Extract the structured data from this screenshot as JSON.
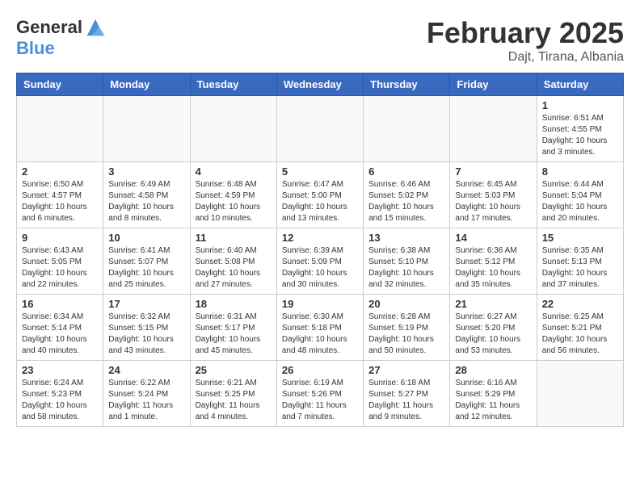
{
  "logo": {
    "line1": "General",
    "line2": "Blue"
  },
  "title": "February 2025",
  "subtitle": "Dajt, Tirana, Albania",
  "days_of_week": [
    "Sunday",
    "Monday",
    "Tuesday",
    "Wednesday",
    "Thursday",
    "Friday",
    "Saturday"
  ],
  "weeks": [
    [
      {
        "day": "",
        "info": ""
      },
      {
        "day": "",
        "info": ""
      },
      {
        "day": "",
        "info": ""
      },
      {
        "day": "",
        "info": ""
      },
      {
        "day": "",
        "info": ""
      },
      {
        "day": "",
        "info": ""
      },
      {
        "day": "1",
        "info": "Sunrise: 6:51 AM\nSunset: 4:55 PM\nDaylight: 10 hours and 3 minutes."
      }
    ],
    [
      {
        "day": "2",
        "info": "Sunrise: 6:50 AM\nSunset: 4:57 PM\nDaylight: 10 hours and 6 minutes."
      },
      {
        "day": "3",
        "info": "Sunrise: 6:49 AM\nSunset: 4:58 PM\nDaylight: 10 hours and 8 minutes."
      },
      {
        "day": "4",
        "info": "Sunrise: 6:48 AM\nSunset: 4:59 PM\nDaylight: 10 hours and 10 minutes."
      },
      {
        "day": "5",
        "info": "Sunrise: 6:47 AM\nSunset: 5:00 PM\nDaylight: 10 hours and 13 minutes."
      },
      {
        "day": "6",
        "info": "Sunrise: 6:46 AM\nSunset: 5:02 PM\nDaylight: 10 hours and 15 minutes."
      },
      {
        "day": "7",
        "info": "Sunrise: 6:45 AM\nSunset: 5:03 PM\nDaylight: 10 hours and 17 minutes."
      },
      {
        "day": "8",
        "info": "Sunrise: 6:44 AM\nSunset: 5:04 PM\nDaylight: 10 hours and 20 minutes."
      }
    ],
    [
      {
        "day": "9",
        "info": "Sunrise: 6:43 AM\nSunset: 5:05 PM\nDaylight: 10 hours and 22 minutes."
      },
      {
        "day": "10",
        "info": "Sunrise: 6:41 AM\nSunset: 5:07 PM\nDaylight: 10 hours and 25 minutes."
      },
      {
        "day": "11",
        "info": "Sunrise: 6:40 AM\nSunset: 5:08 PM\nDaylight: 10 hours and 27 minutes."
      },
      {
        "day": "12",
        "info": "Sunrise: 6:39 AM\nSunset: 5:09 PM\nDaylight: 10 hours and 30 minutes."
      },
      {
        "day": "13",
        "info": "Sunrise: 6:38 AM\nSunset: 5:10 PM\nDaylight: 10 hours and 32 minutes."
      },
      {
        "day": "14",
        "info": "Sunrise: 6:36 AM\nSunset: 5:12 PM\nDaylight: 10 hours and 35 minutes."
      },
      {
        "day": "15",
        "info": "Sunrise: 6:35 AM\nSunset: 5:13 PM\nDaylight: 10 hours and 37 minutes."
      }
    ],
    [
      {
        "day": "16",
        "info": "Sunrise: 6:34 AM\nSunset: 5:14 PM\nDaylight: 10 hours and 40 minutes."
      },
      {
        "day": "17",
        "info": "Sunrise: 6:32 AM\nSunset: 5:15 PM\nDaylight: 10 hours and 43 minutes."
      },
      {
        "day": "18",
        "info": "Sunrise: 6:31 AM\nSunset: 5:17 PM\nDaylight: 10 hours and 45 minutes."
      },
      {
        "day": "19",
        "info": "Sunrise: 6:30 AM\nSunset: 5:18 PM\nDaylight: 10 hours and 48 minutes."
      },
      {
        "day": "20",
        "info": "Sunrise: 6:28 AM\nSunset: 5:19 PM\nDaylight: 10 hours and 50 minutes."
      },
      {
        "day": "21",
        "info": "Sunrise: 6:27 AM\nSunset: 5:20 PM\nDaylight: 10 hours and 53 minutes."
      },
      {
        "day": "22",
        "info": "Sunrise: 6:25 AM\nSunset: 5:21 PM\nDaylight: 10 hours and 56 minutes."
      }
    ],
    [
      {
        "day": "23",
        "info": "Sunrise: 6:24 AM\nSunset: 5:23 PM\nDaylight: 10 hours and 58 minutes."
      },
      {
        "day": "24",
        "info": "Sunrise: 6:22 AM\nSunset: 5:24 PM\nDaylight: 11 hours and 1 minute."
      },
      {
        "day": "25",
        "info": "Sunrise: 6:21 AM\nSunset: 5:25 PM\nDaylight: 11 hours and 4 minutes."
      },
      {
        "day": "26",
        "info": "Sunrise: 6:19 AM\nSunset: 5:26 PM\nDaylight: 11 hours and 7 minutes."
      },
      {
        "day": "27",
        "info": "Sunrise: 6:18 AM\nSunset: 5:27 PM\nDaylight: 11 hours and 9 minutes."
      },
      {
        "day": "28",
        "info": "Sunrise: 6:16 AM\nSunset: 5:29 PM\nDaylight: 11 hours and 12 minutes."
      },
      {
        "day": "",
        "info": ""
      }
    ]
  ]
}
